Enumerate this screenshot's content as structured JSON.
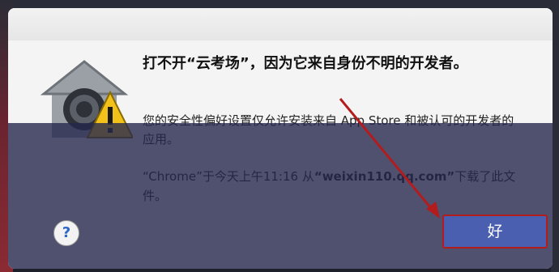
{
  "dialog": {
    "headline": "打不开“云考场”，因为它来自身份不明的开发者。",
    "message": "您的安全性偏好设置仅允许安装来自 App Store 和被认可的开发者的应用。",
    "source_prefix": "“Chrome”于今天上午11:16 从",
    "source_domain": "“weixin110.qq.com”",
    "source_suffix": "下载了此文件。",
    "help_label": "?",
    "ok_label": "好"
  },
  "colors": {
    "accent_button": "#4a5fb0",
    "annotation_red": "#b21c1c",
    "overlay": "#26284e"
  }
}
